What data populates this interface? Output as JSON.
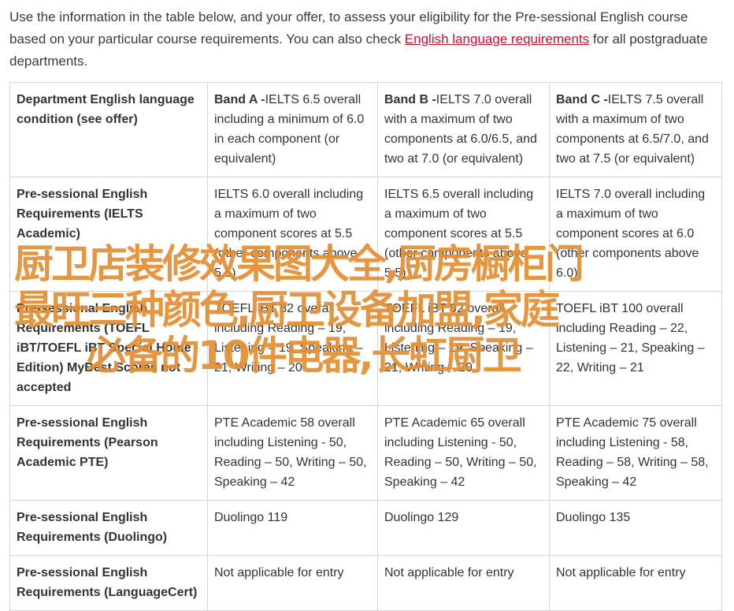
{
  "intro": {
    "before_link": "Use the information in the table below, and your offer, to assess your eligibility for the Pre-sessional English course based on your particular course requirements. You can also check ",
    "link_text": "English language requirements",
    "after_link": " for all postgraduate departments."
  },
  "table": {
    "header": {
      "rowhead": "Department English language condition (see offer)",
      "bands": [
        {
          "label": "Band A -",
          "text": "IELTS 6.5 overall including a minimum of 6.0 in each component (or equivalent)"
        },
        {
          "label": "Band B -",
          "text": "IELTS 7.0 overall with a maximum of two components at 6.0/6.5, and two at 7.0 (or equivalent)"
        },
        {
          "label": "Band C -",
          "text": "IELTS 7.5 overall with a maximum of two components at 6.5/7.0, and two at 7.5 (or equivalent)"
        }
      ]
    },
    "rows": [
      {
        "rowhead": "Pre-sessional English Requirements (IELTS Academic)",
        "cells": [
          "IELTS 6.0 overall including a maximum of two component scores at 5.5 (other components above 5.5)",
          "IELTS 6.5 overall including a maximum of two component scores at 5.5 (other components above 5.5)",
          "IELTS 7.0 overall including a maximum of two component scores at 6.0 (other components above 6.0)"
        ]
      },
      {
        "rowhead": "Pre-sessional English Requirements (TOEFL iBT/TOEFL iBT Special Home Edition) MyBest Scores not accepted",
        "cells": [
          "TOEFL iBT 82 overall including Reading – 19, Listening – 19, Speaking – 21, Writing – 20",
          "TOEFL iBT 92 overall including Reading – 19, Listening – 19, Speaking – 21, Writing – 20",
          "TOEFL iBT 100 overall including Reading – 22, Listening – 21, Speaking – 22, Writing – 21"
        ]
      },
      {
        "rowhead": "Pre-sessional English Requirements (Pearson Academic PTE)",
        "cells": [
          "PTE Academic 58 overall including Listening - 50, Reading – 50, Writing – 50, Speaking – 42",
          "PTE Academic 65 overall including Listening - 50, Reading – 50, Writing – 50, Speaking – 42",
          "PTE Academic 75 overall including Listening - 58, Reading – 58, Writing – 58, Speaking – 42"
        ]
      },
      {
        "rowhead": "Pre-sessional English Requirements (Duolingo)",
        "cells": [
          "Duolingo 119",
          "Duolingo 129",
          "Duolingo 135"
        ]
      },
      {
        "rowhead": "Pre-sessional English Requirements (LanguageCert)",
        "cells": [
          "Not applicable for entry",
          "Not applicable for entry",
          "Not applicable for entry"
        ]
      }
    ]
  },
  "watermark": {
    "line1": "厨卫店装修效果图大全,厨房橱柜门",
    "line2": "最旺三种颜色,厨卫设备加盟,家庭",
    "line3": "必备的10件电器,长虹厨卫"
  },
  "colors": {
    "link": "#c8102e",
    "watermark": "#e28e32",
    "border": "#d5d5d5"
  }
}
